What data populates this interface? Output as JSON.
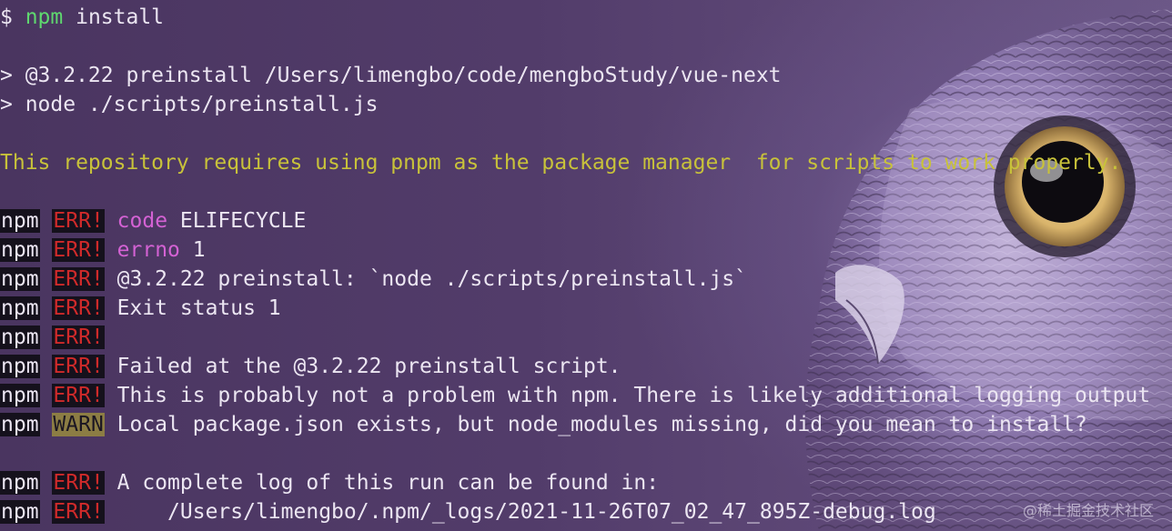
{
  "terminal": {
    "line1": {
      "prompt": "$ ",
      "cmd": "npm",
      "args": " install"
    },
    "line2": "> @3.2.22 preinstall /Users/limengbo/code/mengboStudy/vue-next",
    "line3": "> node ./scripts/preinstall.js",
    "line4": "This repository requires using pnpm as the package manager  for scripts to work properly.",
    "err_tag_npm": "npm",
    "err_tag_err": "ERR!",
    "warn_tag": "WARN",
    "log": [
      {
        "key": "code",
        "value": " ELIFECYCLE"
      },
      {
        "key": "errno",
        "value": " 1"
      }
    ],
    "err_lines": [
      " @3.2.22 preinstall: `node ./scripts/preinstall.js`",
      " Exit status 1",
      "",
      " Failed at the @3.2.22 preinstall script.",
      " This is probably not a problem with npm. There is likely additional logging output"
    ],
    "warn_line": " Local package.json exists, but node_modules missing, did you mean to install?",
    "final_lines": [
      " A complete log of this run can be found in:",
      "     /Users/limengbo/.npm/_logs/2021-11-26T07_02_47_895Z-debug.log"
    ]
  },
  "watermark": "@稀土掘金技术社区",
  "colors": {
    "npm_command": "#5fd86f",
    "warning_text": "#c8c23a",
    "err_tag": "#d02a2a",
    "key_highlight": "#d462d4",
    "warn_tag_bg": "#8c7d44"
  }
}
